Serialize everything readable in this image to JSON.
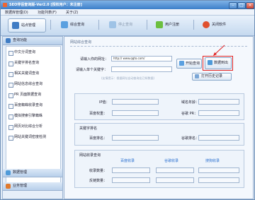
{
  "window": {
    "title": "SEO伴侣查询版-Ver2.0 [授权用户：未注册]",
    "controls": [
      "–",
      "□",
      "×"
    ]
  },
  "menu": [
    "数据库管理(D)",
    "功能列表(F)",
    "关于(Z)"
  ],
  "toolbar": {
    "buttons": [
      {
        "label": "站点管理",
        "icon": "site-manage-icon",
        "color": "#3f7cc4"
      },
      {
        "label": "综合查询",
        "icon": "query-icon",
        "color": "#5aa0e0"
      },
      {
        "label": "停止查询",
        "icon": "stop-icon",
        "color": "#7fb0e0"
      },
      {
        "label": "用户注册",
        "icon": "register-icon",
        "color": "#6cbf3f"
      },
      {
        "label": "关闭软件",
        "icon": "power-icon",
        "color": "#e0502e"
      }
    ]
  },
  "sidebar": {
    "section_label": "查询功能",
    "items": [
      "中文分词查询",
      "关键字排名查询",
      "相关关键词查询",
      "网站信息综合查询",
      "PR 页面数据查询",
      "百度蜘蛛收录查询",
      "模拟搜索引擎蜘蛛",
      "网页对比综合分析",
      "网站关键词密度检测"
    ],
    "bottom": [
      {
        "label": "数据管理",
        "icon": "database-icon"
      },
      {
        "label": "业务管理",
        "icon": "business-icon"
      }
    ]
  },
  "main": {
    "heading": "网站综合查询",
    "url_label": "请输入你的网址：",
    "url_value": "http:// www.qqto.com/",
    "keyword_label": "请输入单个关键字：",
    "keyword_value": "",
    "hint": "(友情提示：根据网址自动查询出已知数据)",
    "buttons": {
      "start": "开始查询",
      "export": "数据到出",
      "history": "打开历史记录"
    },
    "info_fields": {
      "ip": "IP值：",
      "domain_age": "域名年龄：",
      "baidu_weight": "百度权重：",
      "google_pr": "谷歌 PR："
    },
    "keyword_rank": {
      "title": "关键字排名",
      "baidu_rank": "百度排名：",
      "google_rank": "谷歌排名："
    },
    "site_index": {
      "title": "网站收录查询",
      "cols": [
        "百度收录",
        "谷歌收录",
        "搜狗收录"
      ],
      "rows": [
        "收录数量：",
        "反链数量："
      ]
    }
  }
}
